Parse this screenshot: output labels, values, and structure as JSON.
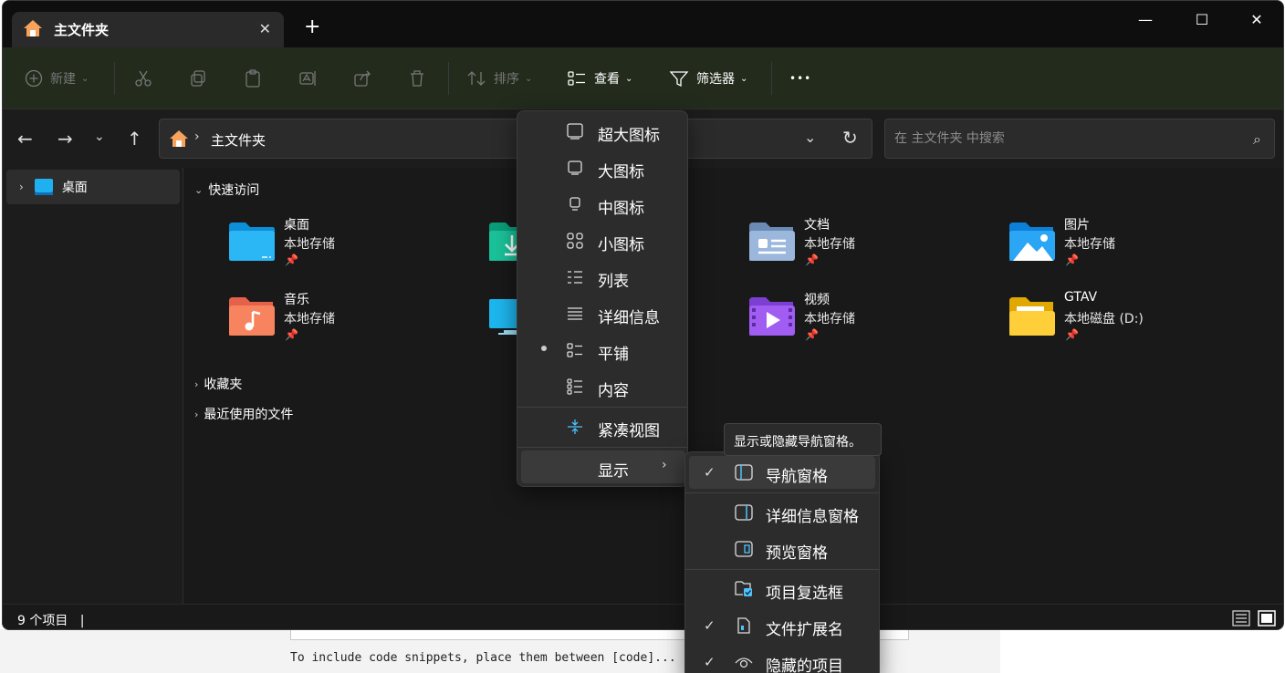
{
  "tab": {
    "title": "主文件夹",
    "close": "✕",
    "new_tab": "+"
  },
  "window_controls": {
    "minimize": "—",
    "maximize": "☐",
    "close": "✕"
  },
  "toolbar": {
    "new_label": "新建",
    "sort_label": "排序",
    "view_label": "查看",
    "filter_label": "筛选器",
    "more": "•••"
  },
  "address": {
    "path": "主文件夹",
    "separator": "›",
    "search_placeholder": "在 主文件夹 中搜索"
  },
  "nav": {
    "items": [
      {
        "label": "桌面",
        "chevron": "›"
      }
    ]
  },
  "sections": {
    "quick_access": "快速访问",
    "favorites": "收藏夹",
    "recent": "最近使用的文件"
  },
  "tiles": [
    {
      "name": "桌面",
      "sub": "本地存储",
      "pinned": true,
      "icon": "desktop-folder"
    },
    {
      "name": "",
      "sub": "",
      "pinned": false,
      "icon": "downloads-folder"
    },
    {
      "name": "文档",
      "sub": "本地存储",
      "pinned": true,
      "icon": "documents-folder"
    },
    {
      "name": "图片",
      "sub": "本地存储",
      "pinned": true,
      "icon": "pictures-folder"
    },
    {
      "name": "音乐",
      "sub": "本地存储",
      "pinned": true,
      "icon": "music-folder"
    },
    {
      "name": "",
      "sub": "",
      "pinned": false,
      "icon": "computer-folder"
    },
    {
      "name": "视频",
      "sub": "本地存储",
      "pinned": true,
      "icon": "videos-folder"
    },
    {
      "name": "GTAV",
      "sub": "本地磁盘 (D:)",
      "pinned": true,
      "icon": "drive-folder"
    }
  ],
  "status": {
    "count": "9 个项目",
    "cursor": "|"
  },
  "view_menu": {
    "items": [
      {
        "label": "超大图标",
        "icon": "extra-large-icons-icon"
      },
      {
        "label": "大图标",
        "icon": "large-icons-icon"
      },
      {
        "label": "中图标",
        "icon": "medium-icons-icon"
      },
      {
        "label": "小图标",
        "icon": "small-icons-icon"
      },
      {
        "label": "列表",
        "icon": "list-icon"
      },
      {
        "label": "详细信息",
        "icon": "details-icon"
      },
      {
        "label": "平铺",
        "icon": "tiles-icon",
        "selected": true
      },
      {
        "label": "内容",
        "icon": "content-icon"
      }
    ],
    "compact": "紧凑视图",
    "show": "显示",
    "show_arrow": "›"
  },
  "show_submenu": {
    "items": [
      {
        "label": "导航窗格",
        "checked": true,
        "icon": "navigation-pane-icon"
      },
      {
        "label": "详细信息窗格",
        "checked": false,
        "icon": "details-pane-icon"
      },
      {
        "label": "预览窗格",
        "checked": false,
        "icon": "preview-pane-icon"
      },
      {
        "label": "项目复选框",
        "checked": false,
        "icon": "item-checkbox-icon"
      },
      {
        "label": "文件扩展名",
        "checked": true,
        "icon": "file-extension-icon"
      },
      {
        "label": "隐藏的项目",
        "checked": true,
        "icon": "hidden-items-icon"
      }
    ],
    "check": "✓"
  },
  "tooltip": "显示或隐藏导航窗格。",
  "background_text": "To include code snippets, place them between [code]...",
  "colors": {
    "accent": "#4cc2ff",
    "window_bg": "#191919",
    "toolbar_bg": "#222b1c",
    "menu_bg": "#2c2c2c"
  }
}
